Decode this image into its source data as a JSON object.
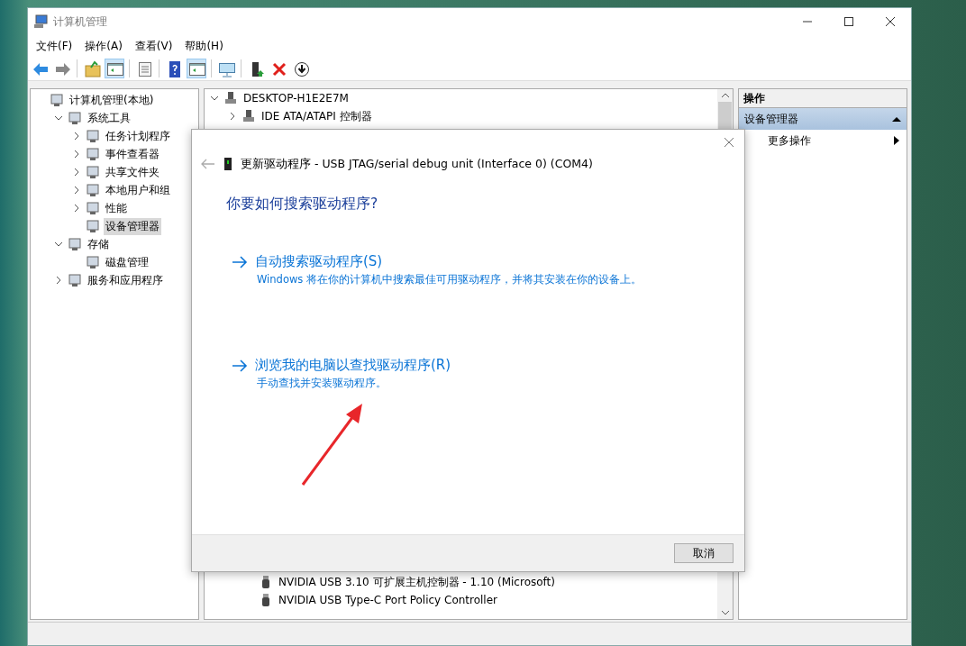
{
  "window": {
    "title": "计算机管理"
  },
  "menu": [
    "文件(F)",
    "操作(A)",
    "查看(V)",
    "帮助(H)"
  ],
  "toolbar": [
    {
      "kind": "back",
      "pressed": false
    },
    {
      "kind": "forward",
      "pressed": false
    },
    {
      "kind": "sep"
    },
    {
      "kind": "up",
      "pressed": false
    },
    {
      "kind": "tree",
      "pressed": true
    },
    {
      "kind": "sep"
    },
    {
      "kind": "props",
      "pressed": false
    },
    {
      "kind": "sep"
    },
    {
      "kind": "help",
      "pressed": false
    },
    {
      "kind": "pane",
      "pressed": true
    },
    {
      "kind": "sep"
    },
    {
      "kind": "monitor",
      "pressed": false
    },
    {
      "kind": "sep"
    },
    {
      "kind": "update",
      "pressed": false
    },
    {
      "kind": "delete",
      "pressed": false
    },
    {
      "kind": "download",
      "pressed": false
    }
  ],
  "left_tree": [
    {
      "label": "计算机管理(本地)",
      "selected": false,
      "children": [
        {
          "label": "系统工具",
          "expanded": true,
          "selected": false,
          "children": [
            {
              "label": "任务计划程序",
              "expanded": false,
              "selected": false
            },
            {
              "label": "事件查看器",
              "expanded": false,
              "selected": false
            },
            {
              "label": "共享文件夹",
              "expanded": false,
              "selected": false
            },
            {
              "label": "本地用户和组",
              "expanded": false,
              "selected": false
            },
            {
              "label": "性能",
              "expanded": false,
              "selected": false
            },
            {
              "label": "设备管理器",
              "selected": true
            }
          ]
        },
        {
          "label": "存储",
          "expanded": true,
          "selected": false,
          "children": [
            {
              "label": "磁盘管理",
              "selected": false
            }
          ]
        },
        {
          "label": "服务和应用程序",
          "expanded": false,
          "selected": false
        }
      ]
    }
  ],
  "device_tree": [
    {
      "label": "DESKTOP-H1E2E7M",
      "expanded": true,
      "children": [
        {
          "label": "IDE ATA/ATAPI 控制器",
          "expanded": false
        }
      ]
    }
  ],
  "device_rows_below": [
    "NVIDIA USB 3.10 可扩展主机控制器 - 1.10 (Microsoft)",
    "NVIDIA USB Type-C Port Policy Controller"
  ],
  "actions": {
    "header": "操作",
    "section": {
      "label": "设备管理器",
      "expanded": true
    },
    "items": [
      "更多操作"
    ]
  },
  "dialog": {
    "title": "更新驱动程序 - USB JTAG/serial debug unit (Interface 0) (COM4)",
    "heading": "你要如何搜索驱动程序?",
    "options": [
      {
        "title": "自动搜索驱动程序(S)",
        "description": "Windows 将在你的计算机中搜索最佳可用驱动程序，并将其安装在你的设备上。"
      },
      {
        "title": "浏览我的电脑以查找驱动程序(R)",
        "description": "手动查找并安装驱动程序。"
      }
    ],
    "cancel": "取消"
  }
}
